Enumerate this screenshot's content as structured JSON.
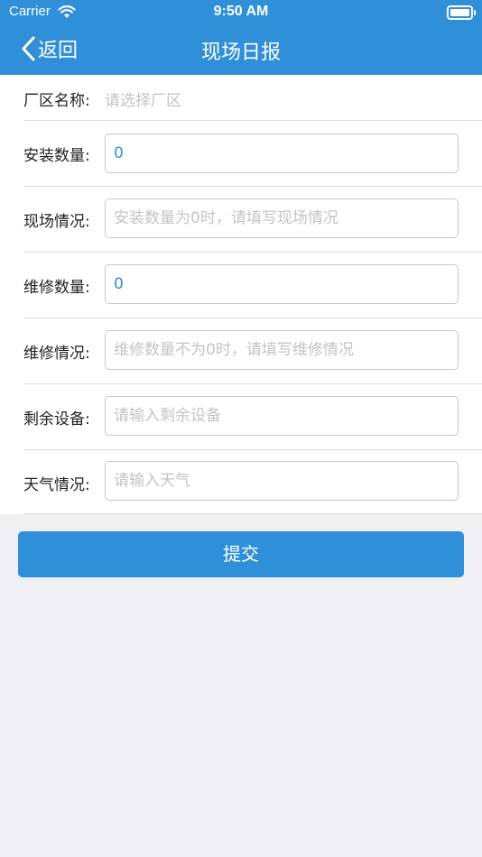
{
  "status_bar": {
    "carrier": "Carrier",
    "time": "9:50 AM"
  },
  "nav": {
    "back_label": "返回",
    "title": "现场日报"
  },
  "form": {
    "factory": {
      "label": "厂区名称:",
      "placeholder": "请选择厂区"
    },
    "install_count": {
      "label": "安装数量:",
      "value": "0"
    },
    "site_status": {
      "label": "现场情况:",
      "placeholder": "安装数量为0时，请填写现场情况"
    },
    "repair_count": {
      "label": "维修数量:",
      "value": "0"
    },
    "repair_status": {
      "label": "维修情况:",
      "placeholder": "维修数量不为0时，请填写维修情况"
    },
    "remaining_equipment": {
      "label": "剩余设备:",
      "placeholder": "请输入剩余设备"
    },
    "weather": {
      "label": "天气情况:",
      "placeholder": "请输入天气"
    }
  },
  "submit_label": "提交",
  "colors": {
    "accent": "#2f8fd8",
    "page_background": "#efeff4",
    "placeholder": "#c4c4c6",
    "label_text": "#222222"
  },
  "icons": [
    "wifi-icon",
    "battery-icon",
    "chevron-left-icon"
  ]
}
